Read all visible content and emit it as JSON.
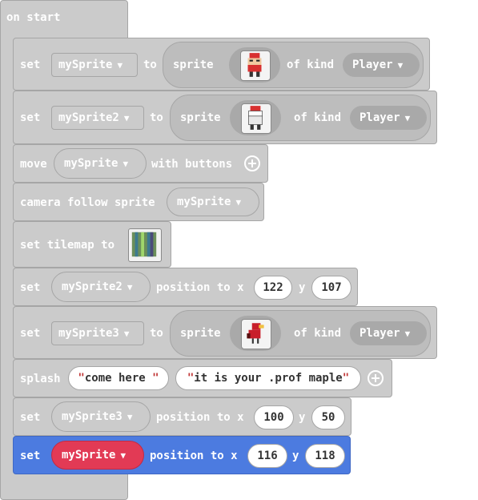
{
  "hat_label": "on start",
  "blocks": {
    "b1": {
      "set": "set",
      "var": "mySprite",
      "to": "to",
      "sprite": "sprite",
      "of_kind": "of kind",
      "kind": "Player"
    },
    "b2": {
      "set": "set",
      "var": "mySprite2",
      "to": "to",
      "sprite": "sprite",
      "of_kind": "of kind",
      "kind": "Player"
    },
    "b3": {
      "move": "move",
      "var": "mySprite",
      "with_buttons": "with buttons"
    },
    "b4": {
      "label": "camera follow sprite",
      "var": "mySprite"
    },
    "b5": {
      "label": "set tilemap to"
    },
    "b6": {
      "set": "set",
      "var": "mySprite2",
      "position_to_x": "position to x",
      "x": "122",
      "y_label": "y",
      "y": "107"
    },
    "b7": {
      "set": "set",
      "var": "mySprite3",
      "to": "to",
      "sprite": "sprite",
      "of_kind": "of kind",
      "kind": "Player"
    },
    "b8": {
      "splash": "splash",
      "text1": "come here ",
      "text2": "it is your .prof maple"
    },
    "b9": {
      "set": "set",
      "var": "mySprite3",
      "position_to_x": "position to x",
      "x": "100",
      "y_label": "y",
      "y": "50"
    },
    "b10": {
      "set": "set",
      "var": "mySprite",
      "position_to_x": "position to x",
      "x": "116",
      "y_label": "y",
      "y": "118"
    }
  },
  "colors": {
    "block_gray": "#cbcbcb",
    "selected_blue": "#4c7be0",
    "variable_red": "#e23a55"
  },
  "dropdown_arrow": "▼"
}
